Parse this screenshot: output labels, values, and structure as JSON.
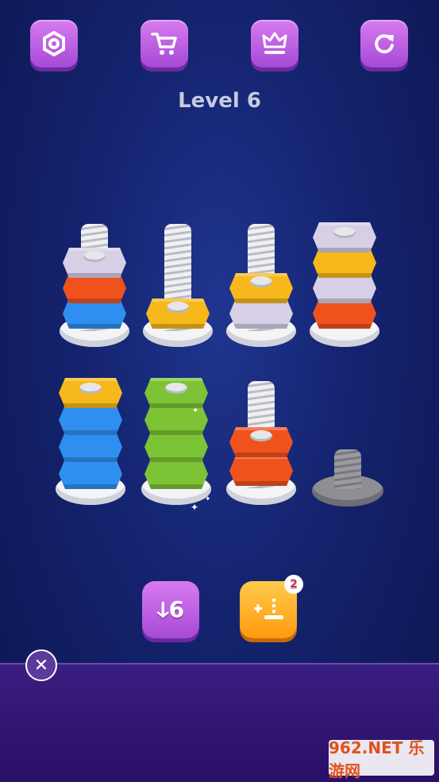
{
  "header": {
    "level_label": "Level 6"
  },
  "top_buttons": [
    {
      "icon": "gear-icon"
    },
    {
      "icon": "cart-icon"
    },
    {
      "icon": "crown-icon"
    },
    {
      "icon": "restart-icon"
    }
  ],
  "colors": {
    "lavender": "#d6cfe6",
    "red": "#f0521e",
    "blue": "#2f8ff0",
    "yellow": "#f6b81b",
    "green": "#7cc435",
    "accent_purple": "#b55ae0",
    "orange_button": "#ffae1a"
  },
  "pegs_top_row": [
    {
      "nuts": [
        "blue",
        "red",
        "lavender"
      ]
    },
    {
      "nuts": [
        "yellow"
      ]
    },
    {
      "nuts": [
        "lavender",
        "yellow"
      ]
    },
    {
      "nuts": [
        "red",
        "lavender",
        "yellow",
        "lavender"
      ]
    }
  ],
  "pegs_bottom_row": [
    {
      "nuts": [
        "blue",
        "blue",
        "blue",
        "yellow"
      ]
    },
    {
      "nuts": [
        "green",
        "green",
        "green",
        "green"
      ]
    },
    {
      "nuts": [
        "red",
        "red"
      ]
    },
    {
      "nuts": [],
      "locked": true
    }
  ],
  "bottom_buttons": {
    "undo_label": "ↆ6",
    "add_bolt_count": "2"
  },
  "ad": {
    "watermark_text": "962.NET 乐游网"
  }
}
